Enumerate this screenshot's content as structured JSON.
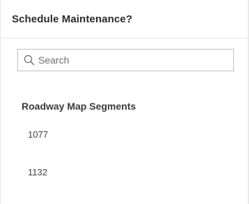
{
  "dialog": {
    "title": "Schedule Maintenance?"
  },
  "search": {
    "placeholder": "Search",
    "value": "",
    "icon": "search-icon"
  },
  "section": {
    "title": "Roadway Map Segments",
    "items": [
      {
        "label": "1077"
      },
      {
        "label": "1132"
      }
    ]
  }
}
